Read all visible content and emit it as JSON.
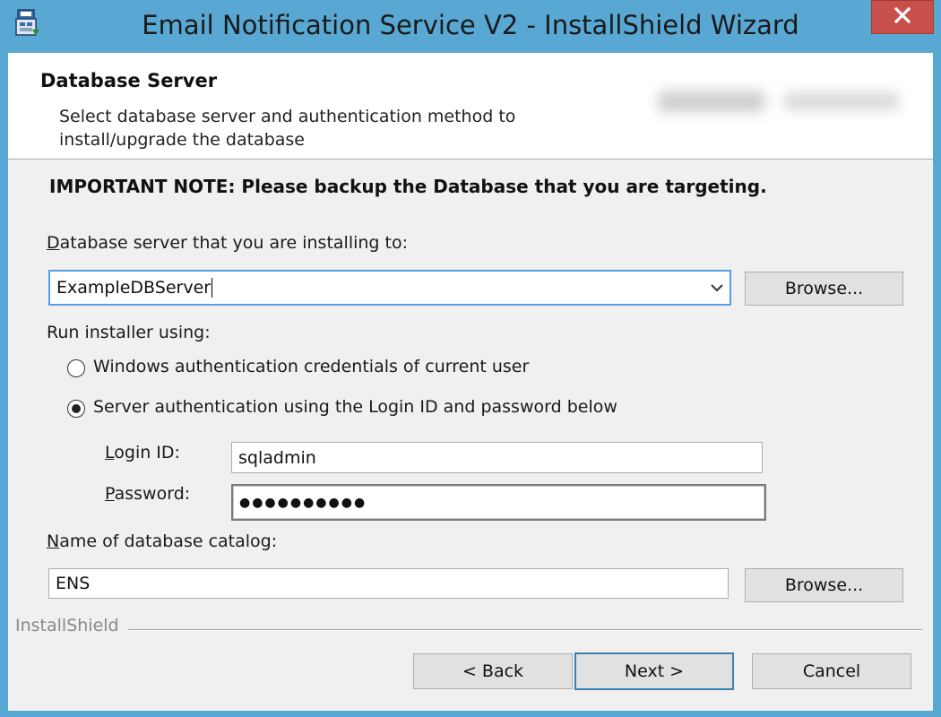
{
  "window": {
    "title": "Email Notification Service V2 - InstallShield Wizard",
    "icon": "installer-icon",
    "close_icon": "close-icon"
  },
  "banner": {
    "title": "Database Server",
    "description": "Select database server and authentication method to install/upgrade the database"
  },
  "important_note": "IMPORTANT NOTE: Please backup the Database that you are targeting.",
  "server": {
    "label_accesskey": "D",
    "label_rest": "atabase server that you are installing to:",
    "value": "ExampleDBServer",
    "dropdown_icon": "chevron-down-icon",
    "browse_label": "Browse..."
  },
  "auth": {
    "run_label": "Run installer using:",
    "options": [
      {
        "label": "Windows authentication credentials of current user",
        "selected": false
      },
      {
        "label": "Server authentication using the Login ID and password below",
        "selected": true
      }
    ]
  },
  "login": {
    "label_accesskey": "L",
    "label_rest": "ogin ID:",
    "value": "sqladmin"
  },
  "password": {
    "label_accesskey": "P",
    "label_rest": "assword:",
    "masked_value": "●●●●●●●●●●"
  },
  "catalog": {
    "label_accesskey": "N",
    "label_rest": "ame of database catalog:",
    "value": "ENS",
    "browse_label": "Browse..."
  },
  "footer": {
    "brand": "InstallShield",
    "back_label": "< Back",
    "next_label": "Next >",
    "cancel_label": "Cancel"
  },
  "colors": {
    "frame": "#59a8d4",
    "close": "#c7504a",
    "focus": "#569de5"
  }
}
